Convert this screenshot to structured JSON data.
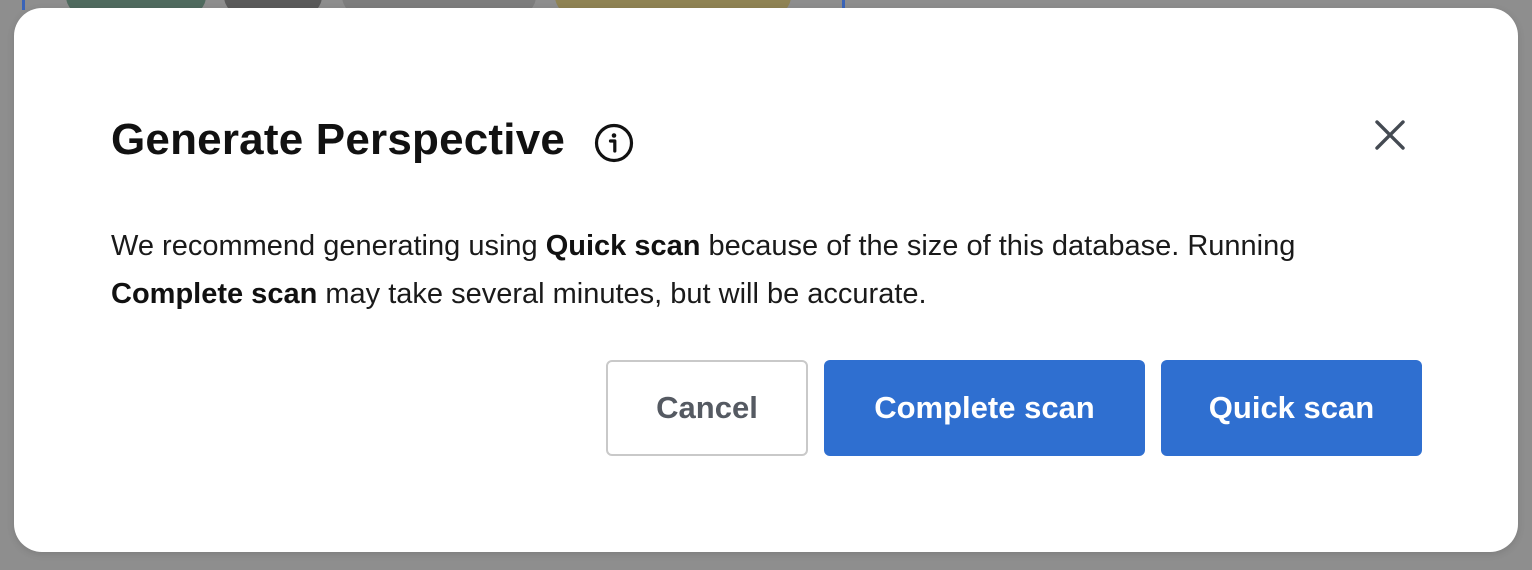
{
  "modal": {
    "title": "Generate Perspective",
    "info_icon": "info-icon",
    "close_icon": "close-icon",
    "body": {
      "part1": "We recommend generating using ",
      "bold1": "Quick scan",
      "part2": " because of the size of this database. Running ",
      "bold2": "Complete scan",
      "part3": " may take several minutes, but will be accurate."
    },
    "buttons": {
      "cancel": "Cancel",
      "complete_scan": "Complete scan",
      "quick_scan": "Quick scan"
    }
  },
  "colors": {
    "primary": "#2f6fd0",
    "overlay": "#8e8e8e"
  }
}
